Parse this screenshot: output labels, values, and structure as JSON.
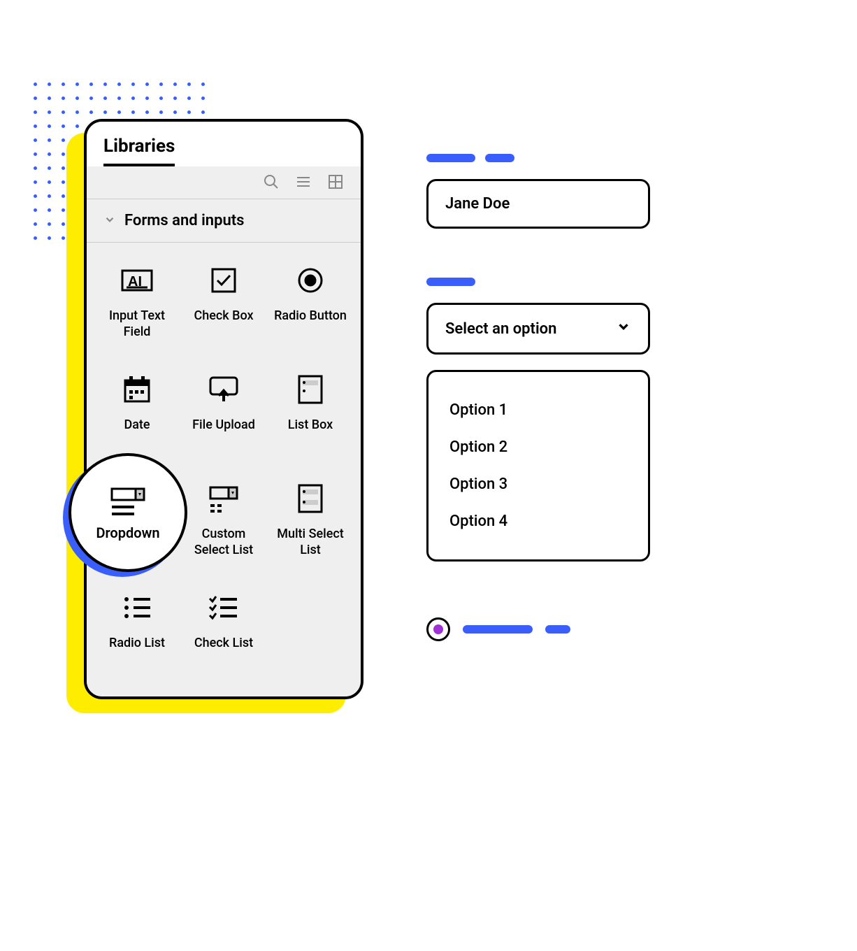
{
  "panel": {
    "title": "Libraries",
    "section_title": "Forms and inputs",
    "items": [
      {
        "label": "Input Text Field"
      },
      {
        "label": "Check Box"
      },
      {
        "label": "Radio Button"
      },
      {
        "label": "Date"
      },
      {
        "label": "File Upload"
      },
      {
        "label": "List Box"
      },
      {
        "label": "Dropdown"
      },
      {
        "label": "Custom Select List"
      },
      {
        "label": "Multi Select List"
      },
      {
        "label": "Radio List"
      },
      {
        "label": "Check List"
      }
    ],
    "highlighted": {
      "label": "Dropdown"
    }
  },
  "preview": {
    "text_field_value": "Jane Doe",
    "select_placeholder": "Select an option",
    "options": [
      "Option 1",
      "Option 2",
      "Option 3",
      "Option 4"
    ]
  }
}
